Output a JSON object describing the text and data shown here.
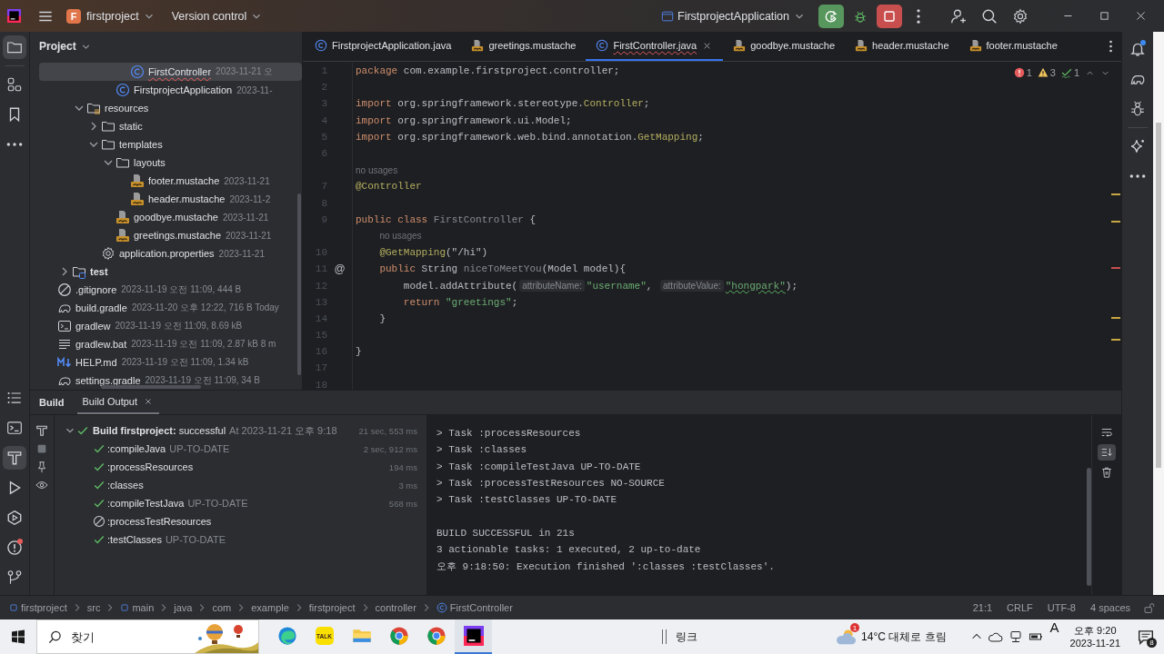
{
  "title_bar": {
    "project_badge": "F",
    "project": "firstproject",
    "vcs": "Version control",
    "run_config": "FirstprojectApplication"
  },
  "left_tools": {
    "top": [
      {
        "kind": "project",
        "selected": true,
        "badge": false
      },
      {
        "kind": "structure",
        "selected": false,
        "badge": false
      },
      {
        "kind": "bookmarks",
        "selected": false,
        "badge": false
      },
      {
        "kind": "more",
        "selected": false,
        "badge": false
      }
    ],
    "bottom": [
      {
        "kind": "list",
        "selected": false,
        "badge": false
      },
      {
        "kind": "terminal",
        "selected": false,
        "badge": false
      },
      {
        "kind": "build",
        "selected": true,
        "badge": false
      },
      {
        "kind": "run",
        "selected": false,
        "badge": false
      },
      {
        "kind": "services",
        "selected": false,
        "badge": false
      },
      {
        "kind": "problems",
        "selected": false,
        "badge": true
      },
      {
        "kind": "git",
        "selected": false,
        "badge": false
      }
    ]
  },
  "right_tools": [
    {
      "kind": "notifications",
      "badge": true
    },
    {
      "kind": "gradle",
      "badge": false
    },
    {
      "kind": "ant",
      "badge": false
    },
    {
      "kind": "ai",
      "badge": false
    },
    {
      "kind": "more",
      "badge": false
    }
  ],
  "project": {
    "title": "Project",
    "tree": [
      {
        "children": [
          {
            "children": [
              {
                "children": [
                  {
                    "children": [
                      {
                        "children": [
                          {
                            "kind": "class",
                            "label": "FirstController",
                            "meta": "2023-11-21 오",
                            "selected": true,
                            "error": true
                          }
                        ]
                      },
                      {
                        "kind": "class",
                        "label": "FirstprojectApplication",
                        "meta": "2023-11-",
                        "selected": false,
                        "error": false
                      }
                    ]
                  }
                ]
              },
              {
                "kind": "resources-folder",
                "label": "resources",
                "expanded": true,
                "selected": false,
                "error": false,
                "children": [
                  {
                    "kind": "folder",
                    "label": "static",
                    "expanded": false,
                    "selected": false,
                    "error": false
                  },
                  {
                    "kind": "folder",
                    "label": "templates",
                    "expanded": true,
                    "selected": false,
                    "error": false,
                    "children": [
                      {
                        "kind": "folder",
                        "label": "layouts",
                        "expanded": true,
                        "selected": false,
                        "error": false,
                        "children": [
                          {
                            "kind": "mustache",
                            "label": "footer.mustache",
                            "meta": "2023-11-21",
                            "selected": false,
                            "error": false
                          },
                          {
                            "kind": "mustache",
                            "label": "header.mustache",
                            "meta": "2023-11-2",
                            "selected": false,
                            "error": false
                          }
                        ]
                      },
                      {
                        "kind": "mustache",
                        "label": "goodbye.mustache",
                        "meta": "2023-11-21",
                        "selected": false,
                        "error": false
                      },
                      {
                        "kind": "mustache",
                        "label": "greetings.mustache",
                        "meta": "2023-11-21",
                        "selected": false,
                        "error": false
                      }
                    ]
                  },
                  {
                    "kind": "settings",
                    "label": "application.properties",
                    "meta": "2023-11-21",
                    "selected": false,
                    "error": false
                  }
                ]
              }
            ]
          },
          {
            "kind": "test-folder",
            "label": "test",
            "expanded": false,
            "selected": false,
            "error": false
          }
        ]
      },
      {
        "kind": "ignore",
        "label": ".gitignore",
        "meta": "2023-11-19 오전 11:09, 444 B",
        "selected": false,
        "error": false
      },
      {
        "kind": "gradle",
        "label": "build.gradle",
        "meta": "2023-11-20 오후 12:22, 716 B Today",
        "selected": false,
        "error": false
      },
      {
        "kind": "terminal",
        "label": "gradlew",
        "meta": "2023-11-19 오전 11:09, 8.69 kB",
        "selected": false,
        "error": false
      },
      {
        "kind": "text",
        "label": "gradlew.bat",
        "meta": "2023-11-19 오전 11:09, 2.87 kB 8 m",
        "selected": false,
        "error": false
      },
      {
        "kind": "markdown",
        "label": "HELP.md",
        "meta": "2023-11-19 오전 11:09, 1.34 kB",
        "selected": false,
        "error": false
      },
      {
        "kind": "gradle",
        "label": "settings.gradle",
        "meta": "2023-11-19 오전 11:09, 34 B",
        "selected": false,
        "error": false
      }
    ]
  },
  "editor": {
    "tabs": [
      {
        "kind": "class",
        "label": "FirstprojectApplication.java",
        "selected": false,
        "error": false
      },
      {
        "kind": "mustache",
        "label": "greetings.mustache",
        "selected": false,
        "error": false
      },
      {
        "kind": "class",
        "label": "FirstController.java",
        "selected": true,
        "error": true
      },
      {
        "kind": "mustache",
        "label": "goodbye.mustache",
        "selected": false,
        "error": false
      },
      {
        "kind": "mustache",
        "label": "header.mustache",
        "selected": false,
        "error": false
      },
      {
        "kind": "mustache",
        "label": "footer.mustache",
        "selected": false,
        "error": false
      }
    ],
    "inspections": {
      "errors": "1",
      "warnings": "3",
      "typos": "1"
    },
    "lines": [
      {
        "kind": "code",
        "number": "1",
        "tokens": [
          {
            "kind": "keyword",
            "text": "package"
          },
          {
            "kind": "plain",
            "text": " com.example.firstproject.controller;"
          }
        ]
      },
      {
        "kind": "code",
        "number": "2"
      },
      {
        "kind": "code",
        "number": "3",
        "tokens": [
          {
            "kind": "keyword",
            "text": "import"
          },
          {
            "kind": "plain",
            "text": " org.springframework.stereotype."
          },
          {
            "kind": "annotation",
            "text": "Controller"
          },
          {
            "kind": "plain",
            "text": ";"
          }
        ]
      },
      {
        "kind": "code",
        "number": "4",
        "tokens": [
          {
            "kind": "keyword",
            "text": "import"
          },
          {
            "kind": "plain",
            "text": " org.springframework.ui.Model;"
          }
        ]
      },
      {
        "kind": "code",
        "number": "5",
        "tokens": [
          {
            "kind": "keyword",
            "text": "import"
          },
          {
            "kind": "plain",
            "text": " org.springframework.web.bind.annotation."
          },
          {
            "kind": "annotation",
            "text": "GetMapping"
          },
          {
            "kind": "plain",
            "text": ";"
          }
        ]
      },
      {
        "kind": "code",
        "number": "6"
      },
      {
        "kind": "hint",
        "tokens": [
          {
            "kind": "usage",
            "text": "no usages"
          }
        ]
      },
      {
        "kind": "code",
        "number": "7",
        "tokens": [
          {
            "kind": "annotation",
            "text": "@Controller"
          }
        ]
      },
      {
        "kind": "code",
        "number": "8"
      },
      {
        "kind": "code",
        "number": "9",
        "tokens": [
          {
            "kind": "keyword",
            "text": "public class "
          },
          {
            "kind": "unused",
            "text": "FirstController"
          },
          {
            "kind": "plain",
            "text": " {"
          }
        ]
      },
      {
        "kind": "hint",
        "tokens": [
          {
            "kind": "indent"
          },
          {
            "kind": "usage",
            "text": "no usages"
          }
        ]
      },
      {
        "kind": "code",
        "number": "10",
        "tokens": [
          {
            "kind": "indent"
          },
          {
            "kind": "annotation",
            "text": "@GetMapping"
          },
          {
            "kind": "plain",
            "text": "(\"/hi\")"
          }
        ]
      },
      {
        "kind": "code",
        "number": "11",
        "gutter": "@",
        "tokens": [
          {
            "kind": "indent"
          },
          {
            "kind": "keyword",
            "text": "public"
          },
          {
            "kind": "plain",
            "text": " String "
          },
          {
            "kind": "unused",
            "text": "niceToMeetYou"
          },
          {
            "kind": "plain",
            "text": "(Model model){"
          }
        ]
      },
      {
        "kind": "code",
        "number": "12",
        "tokens": [
          {
            "kind": "indent"
          },
          {
            "kind": "indent"
          },
          {
            "kind": "plain",
            "text": "model.addAttribute("
          },
          {
            "kind": "param",
            "text": "attributeName:"
          },
          {
            "kind": "string",
            "text": "\"username\""
          },
          {
            "kind": "plain",
            "text": ", "
          },
          {
            "kind": "param",
            "text": "attributeValue:"
          },
          {
            "kind": "typo",
            "text": "\"hongpark\""
          },
          {
            "kind": "plain",
            "text": ");"
          }
        ]
      },
      {
        "kind": "code",
        "number": "13",
        "tokens": [
          {
            "kind": "indent"
          },
          {
            "kind": "indent"
          },
          {
            "kind": "keyword",
            "text": "return "
          },
          {
            "kind": "string",
            "text": "\"greetings\""
          },
          {
            "kind": "plain",
            "text": ";"
          }
        ]
      },
      {
        "kind": "code",
        "number": "14",
        "tokens": [
          {
            "kind": "indent"
          },
          {
            "kind": "plain",
            "text": "}"
          }
        ]
      },
      {
        "kind": "code",
        "number": "15"
      },
      {
        "kind": "code",
        "number": "16",
        "tokens": [
          {
            "kind": "plain",
            "text": "}"
          }
        ]
      },
      {
        "kind": "code",
        "number": "17"
      },
      {
        "kind": "code",
        "number": "18"
      }
    ]
  },
  "build": {
    "title": "Build",
    "tabs": [
      {
        "label": "Build Output",
        "selected": true
      }
    ],
    "tools": [
      {
        "kind": "hammer"
      },
      {
        "kind": "stop"
      },
      {
        "kind": "pin"
      },
      {
        "kind": "eye"
      }
    ],
    "tree": {
      "label": "**Build firstproject:** successful",
      "when": "At 2023-11-21 오후 9:18",
      "duration": "21 sec, 553 ms",
      "kind": "success",
      "expanded": true,
      "children": [
        {
          "label": ":compileJava",
          "note": "UP-TO-DATE",
          "duration": "2 sec, 912 ms",
          "kind": "success"
        },
        {
          "label": ":processResources",
          "duration": "194 ms",
          "kind": "success"
        },
        {
          "label": ":classes",
          "duration": "3 ms",
          "kind": "success"
        },
        {
          "label": ":compileTestJava",
          "note": "UP-TO-DATE",
          "duration": "568 ms",
          "kind": "success"
        },
        {
          "label": ":processTestResources",
          "kind": "skipped"
        },
        {
          "label": ":testClasses",
          "note": "UP-TO-DATE",
          "kind": "success"
        }
      ]
    },
    "output": {
      "lines": [
        "> Task :processResources",
        "> Task :classes",
        "> Task :compileTestJava UP-TO-DATE",
        "> Task :processTestResources NO-SOURCE",
        "> Task :testClasses UP-TO-DATE"
      ],
      "summary": [
        "BUILD SUCCESSFUL in 21s",
        "3 actionable tasks: 1 executed, 2 up-to-date",
        "오후 9:18:50: Execution finished ':classes :testClasses'."
      ]
    },
    "output_tools": [
      {
        "kind": "wrap",
        "selected": false
      },
      {
        "kind": "scroll-end",
        "selected": true
      },
      {
        "kind": "clear",
        "selected": false
      }
    ]
  },
  "status_bar": {
    "breadcrumbs": [
      {
        "kind": "module",
        "label": "firstproject"
      },
      {
        "kind": "folder",
        "label": "src"
      },
      {
        "kind": "module",
        "label": "main"
      },
      {
        "kind": "folder",
        "label": "java"
      },
      {
        "kind": "folder",
        "label": "com"
      },
      {
        "kind": "folder",
        "label": "example"
      },
      {
        "kind": "folder",
        "label": "firstproject"
      },
      {
        "kind": "folder",
        "label": "controller"
      },
      {
        "kind": "class",
        "label": "FirstController"
      }
    ],
    "items": [
      "21:1",
      "CRLF",
      "UTF-8",
      "4 spaces"
    ]
  },
  "taskbar": {
    "search_placeholder": "찾기",
    "apps": [
      {
        "kind": "edge",
        "selected": false
      },
      {
        "kind": "talk",
        "label": "TALK",
        "selected": false
      },
      {
        "kind": "explorer",
        "selected": false
      },
      {
        "kind": "chrome",
        "selected": false
      },
      {
        "kind": "chrome",
        "selected": false
      },
      {
        "kind": "intellij",
        "selected": true
      }
    ],
    "toolbar_label": "링크",
    "weather": {
      "badge": "1",
      "text": "14°C 대체로 흐림"
    },
    "ime": "A",
    "time": "오후 9:20",
    "date": "2023-11-21",
    "notifications": "8"
  }
}
